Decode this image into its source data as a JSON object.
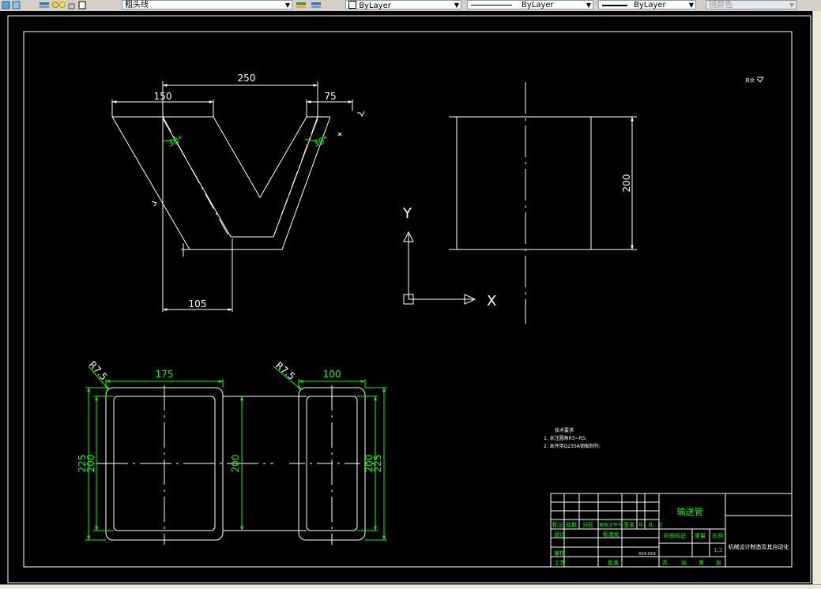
{
  "toolbar": {
    "linetype_label": "粗头线",
    "color_layer": "ByLayer",
    "linetype_layer": "ByLayer",
    "lineweight_layer": "ByLayer",
    "plotstyle": "随颜色"
  },
  "drawing": {
    "dims": {
      "top_width": "250",
      "left_arm": "150",
      "right_arm": "75",
      "angle_left": "30°",
      "angle_right": "30°",
      "bottom_offset": "105",
      "side_height": "200",
      "left_box_width": "175",
      "left_radius": "R7.5",
      "left_height_outer": "225",
      "left_height_inner": "200",
      "mid_height": "200",
      "right_box_width": "100",
      "right_radius": "R7.5",
      "right_height_inner": "200",
      "right_height_outer": "225"
    },
    "ucs": {
      "x": "X",
      "y": "Y"
    },
    "roughness_note": "其余",
    "notes": {
      "heading": "技术要求",
      "line1": "1. 未注圆角R3~R5;",
      "line2": "2. 本件用Q235A钢板制作;"
    },
    "title_block": {
      "part_name": "输送管",
      "company": "机械设计制造及其自动化",
      "scale": "1:1",
      "headers": [
        "标记",
        "处数",
        "分区",
        "更改文件号",
        "签名",
        "年、月、日"
      ],
      "design": "设计",
      "standardize": "标准化",
      "stage": "阶段标记",
      "weight": "重量",
      "scale_label": "比例",
      "audit": "审核",
      "process": "工艺",
      "approve": "批准",
      "sheet_row": [
        "共",
        "张",
        "第",
        "张"
      ],
      "code": "XXX-XXX"
    }
  },
  "colors": {
    "canvas_bg": "#000000",
    "geometry": "#ffffff",
    "dimension": "#00ff00"
  }
}
